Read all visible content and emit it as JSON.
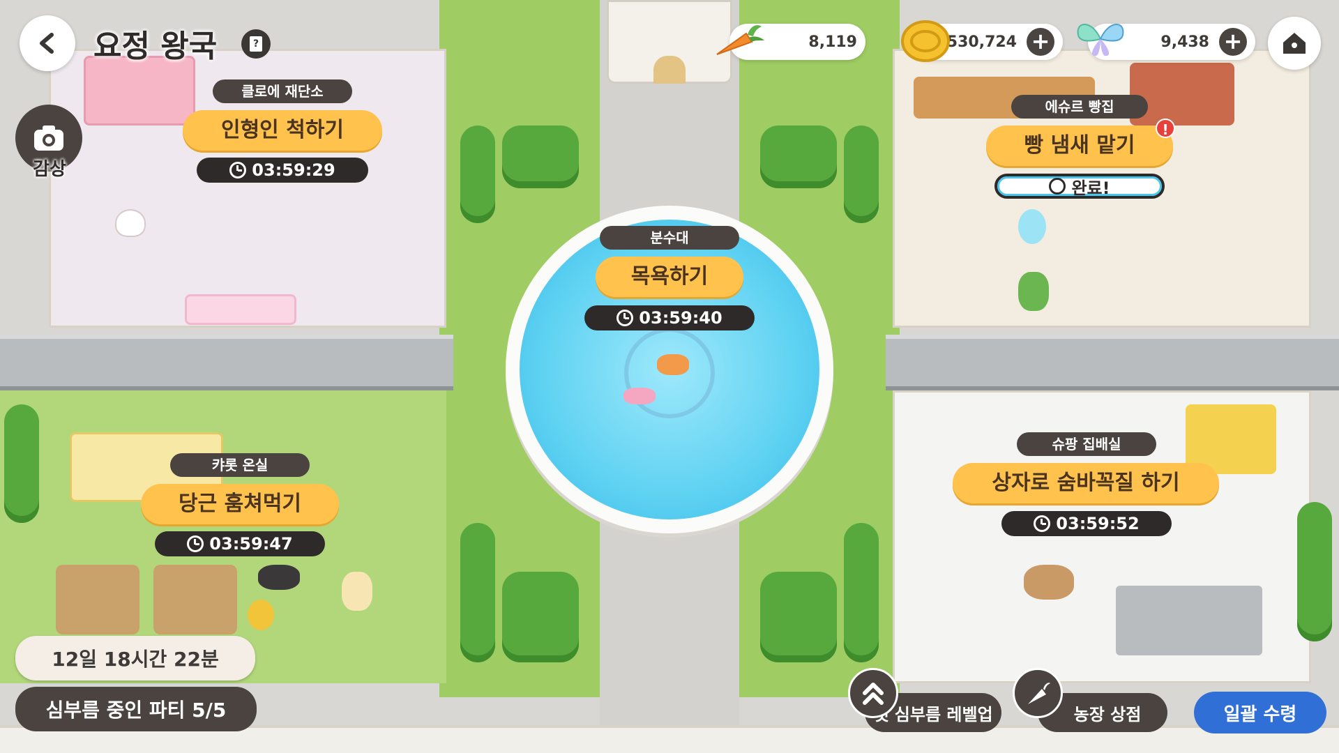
{
  "header": {
    "title": "요정 왕국",
    "help_icon": "help-book-icon",
    "back_icon": "back-arrow-icon",
    "home_icon": "home-icon"
  },
  "camera": {
    "label": "감상",
    "icon": "camera-icon"
  },
  "resources": {
    "carrot": {
      "value": "8,119",
      "icon": "carrot-icon"
    },
    "coin": {
      "value": "1,530,724",
      "icon": "coin-icon"
    },
    "butterfly": {
      "value": "9,438",
      "icon": "butterfly-icon"
    }
  },
  "stations": {
    "doll": {
      "place": "클로에 재단소",
      "action": "인형인 척하기",
      "timer": "03:59:29"
    },
    "bakery": {
      "place": "에슈르 빵집",
      "action": "빵 냄새 맡기",
      "timer": "완료!"
    },
    "fountain": {
      "place": "분수대",
      "action": "목욕하기",
      "timer": "03:59:40"
    },
    "greenhouse": {
      "place": "캬롯 온실",
      "action": "당근 훔쳐먹기",
      "timer": "03:59:47"
    },
    "delivery": {
      "place": "슈팡 집배실",
      "action": "상자로 숨바꼭질 하기",
      "timer": "03:59:52"
    }
  },
  "bottom": {
    "time_remaining": "12일 18시간 22분",
    "party": "심부름 중인 파티 5/5",
    "levelup": "펫 심부름 레벨업",
    "shop": "농장 상점",
    "collect": "일괄 수령"
  },
  "colors": {
    "action_pill": "#ffc24d",
    "dark_pill": "#4a4340",
    "collect_button": "#2f6fd6",
    "done_timer": "#48c6ee",
    "grass": "#a6d06a",
    "water": "#5fd2f2"
  }
}
